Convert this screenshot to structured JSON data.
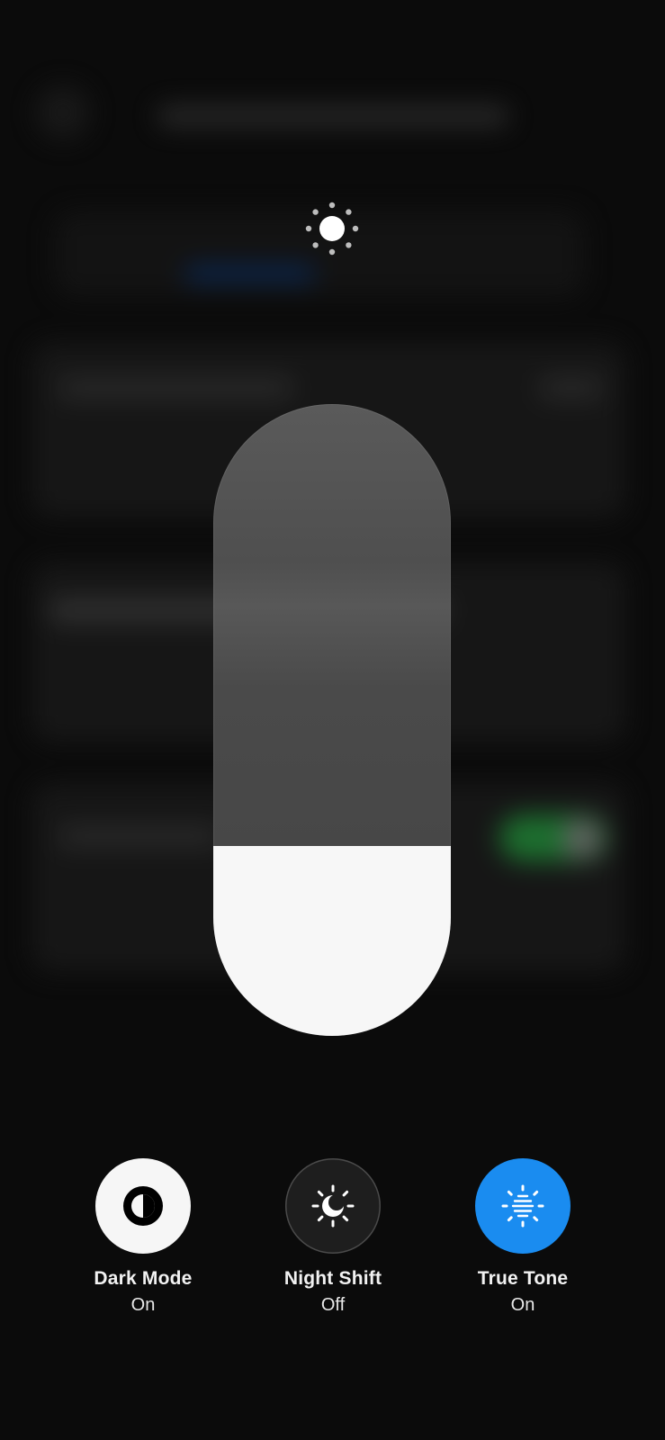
{
  "brightness": {
    "icon": "sun-icon",
    "level": 0.3
  },
  "controls": [
    {
      "id": "dark-mode",
      "label": "Dark Mode",
      "state": "On",
      "icon": "dark-mode-icon",
      "color": "#f6f6f6"
    },
    {
      "id": "night-shift",
      "label": "Night Shift",
      "state": "Off",
      "icon": "night-shift-icon",
      "color": "#1e1e1e"
    },
    {
      "id": "true-tone",
      "label": "True Tone",
      "state": "On",
      "icon": "true-tone-icon",
      "color": "#1a8cf0"
    }
  ]
}
